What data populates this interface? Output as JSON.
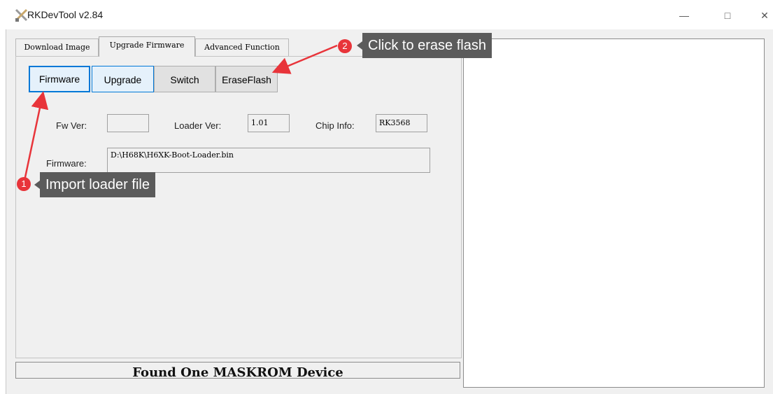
{
  "window": {
    "title": "RKDevTool v2.84"
  },
  "tabs": [
    {
      "label": "Download Image"
    },
    {
      "label": "Upgrade Firmware"
    },
    {
      "label": "Advanced Function"
    }
  ],
  "buttons": {
    "firmware": "Firmware",
    "upgrade": "Upgrade",
    "switch": "Switch",
    "erase_flash": "EraseFlash"
  },
  "info": {
    "fw_ver_label": "Fw Ver:",
    "fw_ver_value": "",
    "loader_ver_label": "Loader Ver:",
    "loader_ver_value": "1.01",
    "chip_info_label": "Chip Info:",
    "chip_info_value": "RK3568",
    "firmware_label": "Firmware:",
    "firmware_path": "D:\\H68K\\H6XK-Boot-Loader.bin"
  },
  "status": {
    "text": "Found One MASKROM Device"
  },
  "annotations": [
    {
      "number": "1",
      "text": "Import loader file"
    },
    {
      "number": "2",
      "text": "Click to erase flash"
    }
  ],
  "colors": {
    "annotation_red": "#e8343a",
    "callout_bg": "#5b5b5b",
    "focus_blue": "#0078d7"
  }
}
